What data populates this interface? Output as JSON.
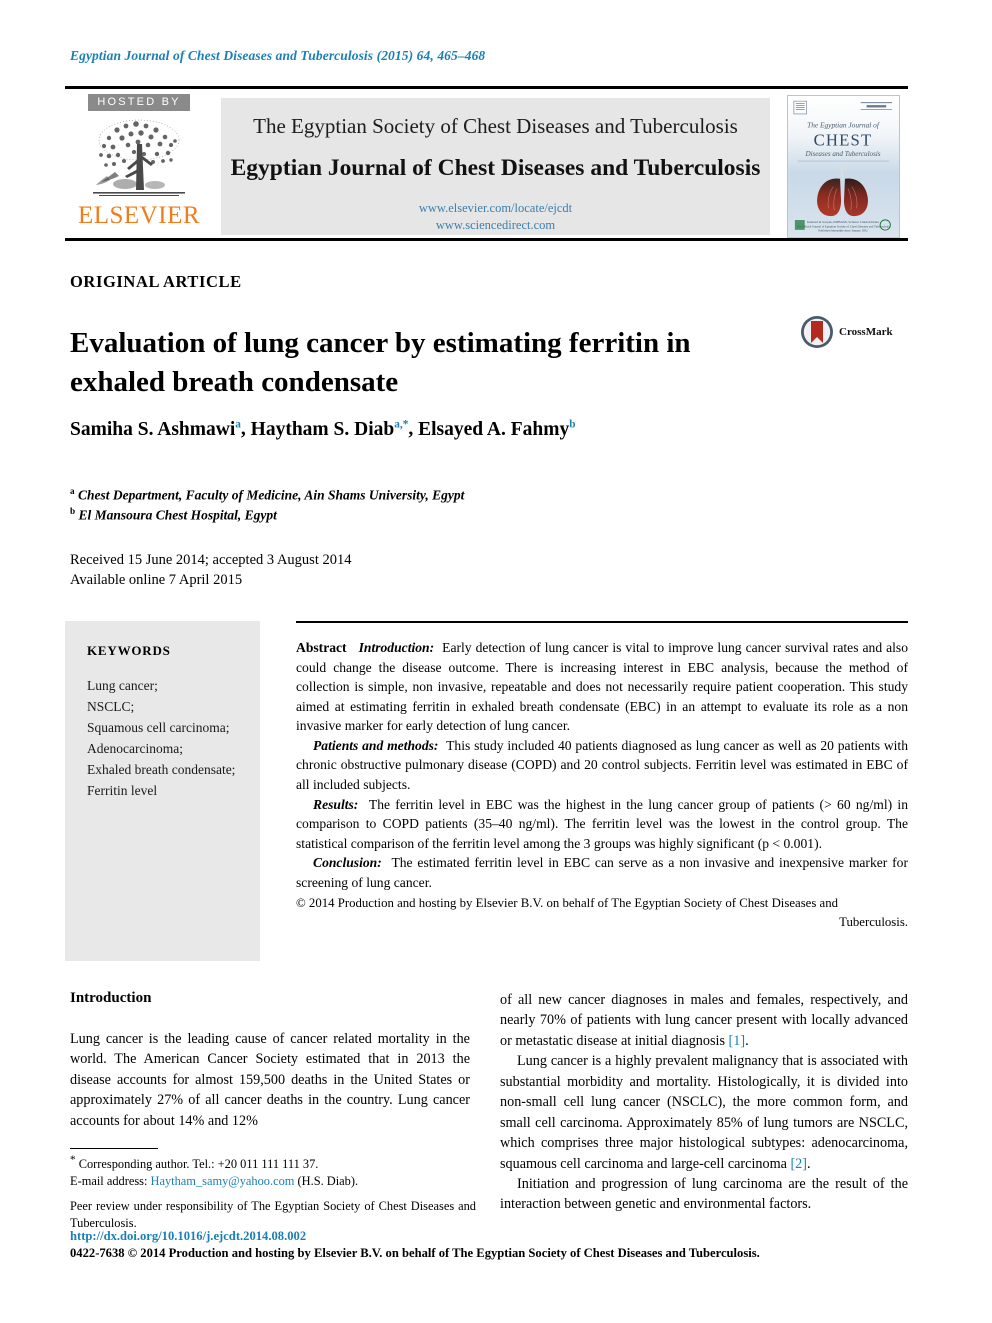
{
  "running_head": "Egyptian Journal of Chest Diseases and Tuberculosis (2015) 64, 465–468",
  "masthead": {
    "hosted_by_label": "HOSTED BY",
    "publisher_name": "ELSEVIER",
    "society_line": "The Egyptian Society of Chest Diseases and Tuberculosis",
    "journal_title": "Egyptian Journal of Chest Diseases and Tuberculosis",
    "url_primary": "www.elsevier.com/locate/ejcdt",
    "url_secondary": "www.sciencedirect.com",
    "cover": {
      "kicker": "The Egyptian Journal of",
      "title": "CHEST",
      "subtitle": "Diseases and Tuberculosis"
    }
  },
  "article": {
    "type": "ORIGINAL ARTICLE",
    "title": "Evaluation of lung cancer by estimating ferritin in exhaled breath condensate",
    "crossmark_label": "CrossMark",
    "authors": [
      {
        "name": "Samiha S. Ashmawi",
        "marks": "a"
      },
      {
        "name": "Haytham S. Diab",
        "marks": "a,*"
      },
      {
        "name": "Elsayed A. Fahmy",
        "marks": "b"
      }
    ],
    "affiliations": [
      {
        "mark": "a",
        "text": "Chest Department, Faculty of Medicine, Ain Shams University, Egypt"
      },
      {
        "mark": "b",
        "text": "El Mansoura Chest Hospital, Egypt"
      }
    ],
    "received_line": "Received 15 June 2014; accepted 3 August 2014",
    "available_line": "Available online 7 April 2015"
  },
  "keywords": {
    "heading": "KEYWORDS",
    "items": [
      "Lung cancer;",
      "NSCLC;",
      "Squamous cell carcinoma;",
      "Adenocarcinoma;",
      "Exhaled breath condensate;",
      "Ferritin level"
    ]
  },
  "abstract": {
    "label": "Abstract",
    "sections": [
      {
        "heading": "Introduction:",
        "text": "Early detection of lung cancer is vital to improve lung cancer survival rates and also could change the disease outcome. There is increasing interest in EBC analysis, because the method of collection is simple, non invasive, repeatable and does not necessarily require patient cooperation. This study aimed at estimating ferritin in exhaled breath condensate (EBC) in an attempt to evaluate its role as a non invasive marker for early detection of lung cancer."
      },
      {
        "heading": "Patients and methods:",
        "text": "This study included 40 patients diagnosed as lung cancer as well as 20 patients with chronic obstructive pulmonary disease (COPD) and 20 control subjects. Ferritin level was estimated in EBC of all included subjects."
      },
      {
        "heading": "Results:",
        "text": "The ferritin level in EBC was the highest in the lung cancer group of patients (> 60 ng/ml) in comparison to COPD patients (35–40 ng/ml). The ferritin level was the lowest in the control group. The statistical comparison of the ferritin level among the 3 groups was highly significant (p < 0.001)."
      },
      {
        "heading": "Conclusion:",
        "text": "The estimated ferritin level in EBC can serve as a non invasive and inexpensive marker for screening of lung cancer."
      }
    ],
    "copyright_main": "© 2014 Production and hosting by Elsevier B.V. on behalf of The Egyptian Society of Chest Diseases and",
    "copyright_tail": "Tuberculosis."
  },
  "introduction": {
    "heading": "Introduction",
    "left_paragraph": "Lung cancer is the leading cause of cancer related mortality in the world. The American Cancer Society estimated that in 2013 the disease accounts for almost 159,500 deaths in the United States or approximately 27% of all cancer deaths in the country. Lung cancer accounts for about 14% and 12%",
    "right_paragraph_1_pre": "of all new cancer diagnoses in males and females, respectively, and nearly 70% of patients with lung cancer present with locally advanced or metastatic disease at initial diagnosis ",
    "right_paragraph_1_ref": "[1]",
    "right_paragraph_1_post": ".",
    "right_paragraph_2_pre": "Lung cancer is a highly prevalent malignancy that is associated with substantial morbidity and mortality. Histologically, it is divided into non-small cell lung cancer (NSCLC), the more common form, and small cell carcinoma. Approximately 85% of lung tumors are NSCLC, which comprises three major histological subtypes: adenocarcinoma, squamous cell carcinoma and large-cell carcinoma ",
    "right_paragraph_2_ref": "[2]",
    "right_paragraph_2_post": ".",
    "right_paragraph_3": "Initiation and progression of lung carcinoma are the result of the interaction between genetic and environmental factors."
  },
  "footnotes": {
    "corresponding": "Corresponding author. Tel.: +20 011 111 111 37.",
    "email_label": "E-mail address:",
    "email": "Haytham_samy@yahoo.com",
    "email_suffix": "(H.S. Diab).",
    "peer_review": "Peer review under responsibility of The Egyptian Society of Chest Diseases and Tuberculosis."
  },
  "footer": {
    "doi": "http://dx.doi.org/10.1016/j.ejcdt.2014.08.002",
    "issn_line": "0422-7638 © 2014 Production and hosting by Elsevier B.V. on behalf of The Egyptian Society of Chest Diseases and Tuberculosis."
  },
  "colors": {
    "link_blue": "#1a7fb5",
    "elsevier_orange": "#ef7d1a",
    "banner_gray": "#e6e6e6",
    "keywords_gray": "#e8e8e8"
  }
}
